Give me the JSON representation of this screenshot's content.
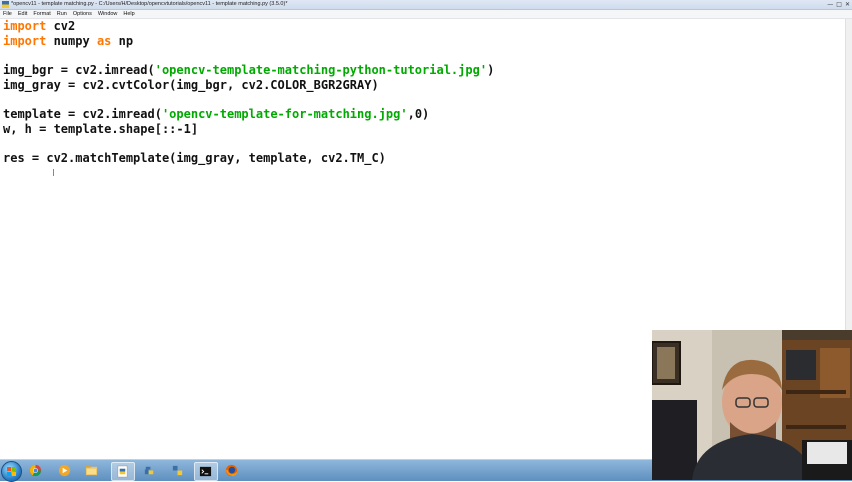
{
  "window": {
    "title": "*opencv11 - template matching.py - C:/Users/H/Desktop/opencvtutorials/opencv11 - template matching.py (3.5.0)*",
    "controls": [
      "—",
      "□",
      "✕"
    ]
  },
  "menu": [
    "File",
    "Edit",
    "Format",
    "Run",
    "Options",
    "Window",
    "Help"
  ],
  "code_lines": [
    {
      "parts": [
        {
          "t": "import",
          "c": "kw"
        },
        {
          "t": " cv2",
          "c": ""
        }
      ]
    },
    {
      "parts": [
        {
          "t": "import",
          "c": "kw"
        },
        {
          "t": " numpy ",
          "c": ""
        },
        {
          "t": "as",
          "c": "kw"
        },
        {
          "t": " np",
          "c": ""
        }
      ]
    },
    {
      "parts": []
    },
    {
      "parts": [
        {
          "t": "img_bgr = cv2.imread(",
          "c": ""
        },
        {
          "t": "'opencv-template-matching-python-tutorial.jpg'",
          "c": "str"
        },
        {
          "t": ")",
          "c": ""
        }
      ]
    },
    {
      "parts": [
        {
          "t": "img_gray = cv2.cvtColor(img_bgr, cv2.COLOR_BGR2GRAY)",
          "c": ""
        }
      ]
    },
    {
      "parts": []
    },
    {
      "parts": [
        {
          "t": "template = cv2.imread(",
          "c": ""
        },
        {
          "t": "'opencv-template-for-matching.jpg'",
          "c": "str"
        },
        {
          "t": ",0)",
          "c": ""
        }
      ]
    },
    {
      "parts": [
        {
          "t": "w, h = template.shape[::-1]",
          "c": ""
        }
      ]
    },
    {
      "parts": []
    },
    {
      "parts": [
        {
          "t": "res = cv2.matchTemplate(img_gray, template, cv2.TM_C)",
          "c": ""
        }
      ]
    }
  ],
  "taskbar": {
    "icons": [
      {
        "name": "chrome-icon",
        "active": false
      },
      {
        "name": "media-player-icon",
        "active": false
      },
      {
        "name": "file-explorer-icon",
        "active": false
      },
      {
        "name": "python-file-icon",
        "active": true
      },
      {
        "name": "python-idle-icon",
        "active": false
      },
      {
        "name": "python-shell-icon",
        "active": false
      },
      {
        "name": "terminal-icon",
        "active": true
      },
      {
        "name": "firefox-icon",
        "active": false
      }
    ]
  },
  "colors": {
    "keyword": "#ff7700",
    "string": "#00aa00",
    "text": "#111111"
  }
}
